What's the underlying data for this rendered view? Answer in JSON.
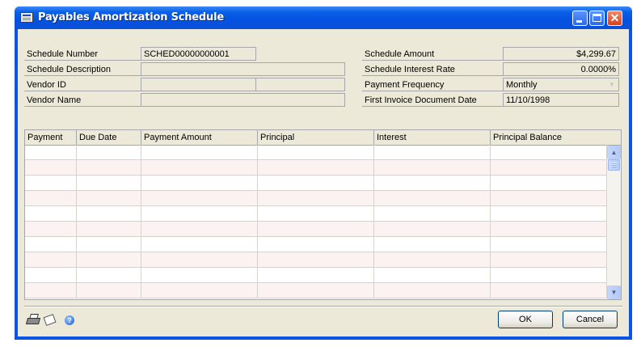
{
  "window": {
    "title": "Payables Amortization Schedule"
  },
  "header": {
    "schedule_number_label": "Schedule Number",
    "schedule_number_value": "SCHED00000000001",
    "schedule_description_label": "Schedule Description",
    "schedule_description_value": "",
    "vendor_id_label": "Vendor ID",
    "vendor_id_value": "",
    "vendor_name_label": "Vendor Name",
    "vendor_name_value": "",
    "schedule_amount_label": "Schedule Amount",
    "schedule_amount_value": "$4,299.67",
    "interest_rate_label": "Schedule Interest Rate",
    "interest_rate_value": "0.0000%",
    "payment_frequency_label": "Payment Frequency",
    "payment_frequency_value": "Monthly",
    "first_invoice_label": "First Invoice Document Date",
    "first_invoice_value": "11/10/1998"
  },
  "grid": {
    "columns": [
      "Payment",
      "Due Date",
      "Payment Amount",
      "Principal",
      "Interest",
      "Principal Balance"
    ],
    "rows": []
  },
  "footer": {
    "ok_label": "OK",
    "cancel_label": "Cancel"
  },
  "icons": {
    "print": "printer-icon",
    "note": "note-icon",
    "help": "help-icon"
  }
}
